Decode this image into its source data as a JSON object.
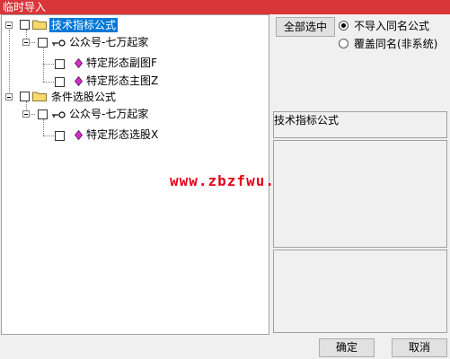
{
  "window": {
    "title": "临时导入"
  },
  "tree": {
    "groups": [
      {
        "label": "技术指标公式",
        "selected": true,
        "child": {
          "label": "公众号-七万起家",
          "items": [
            "特定形态副图F",
            "特定形态主图Z"
          ]
        }
      },
      {
        "label": "条件选股公式",
        "selected": false,
        "child": {
          "label": "公众号-七万起家",
          "items": [
            "特定形态选股X"
          ]
        }
      }
    ]
  },
  "watermark": "www.zbzfwu.com",
  "right_panel": {
    "select_all_label": "全部选中",
    "options": [
      {
        "label": "不导入同名公式",
        "checked": true
      },
      {
        "label": "覆盖同名(非系统)",
        "checked": false
      }
    ],
    "formula_type_label": "技术指标公式"
  },
  "footer": {
    "ok_label": "确定",
    "cancel_label": "取消"
  },
  "colors": {
    "titlebar": "#d9363a",
    "selection": "#0078d7",
    "watermark": "#e4001b"
  }
}
